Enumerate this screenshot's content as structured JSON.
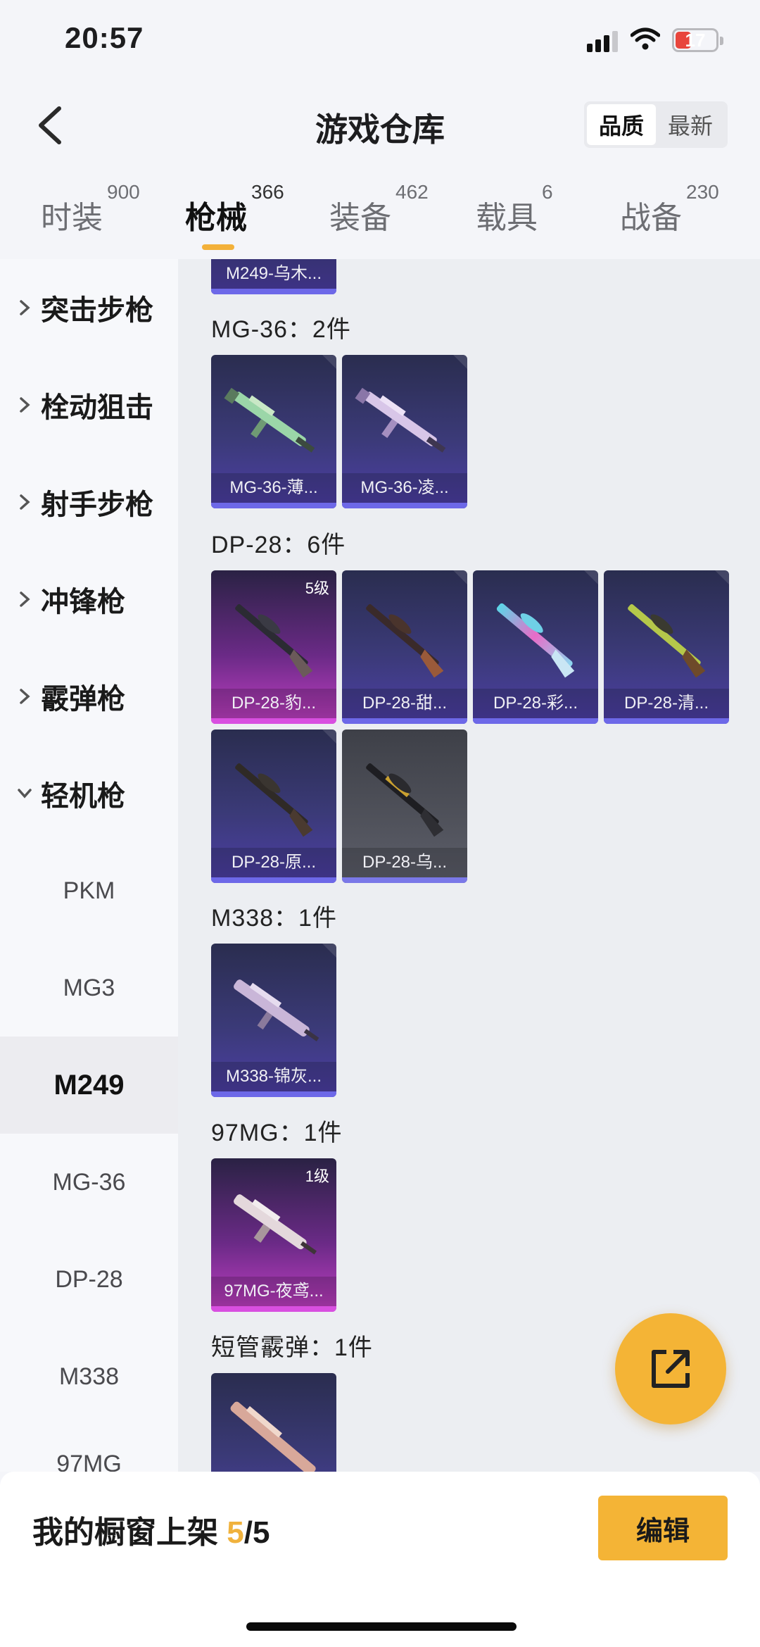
{
  "status_bar": {
    "time": "20:57",
    "battery": "17"
  },
  "header": {
    "title": "游戏仓库",
    "sort_options": [
      "品质",
      "最新"
    ]
  },
  "tabs": [
    {
      "label": "时装",
      "count": "900"
    },
    {
      "label": "枪械",
      "count": "366"
    },
    {
      "label": "装备",
      "count": "462"
    },
    {
      "label": "载具",
      "count": "6"
    },
    {
      "label": "战备",
      "count": "230"
    }
  ],
  "sidebar": {
    "categories": [
      "突击步枪",
      "栓动狙击",
      "射手步枪",
      "冲锋枪",
      "霰弹枪",
      "轻机枪"
    ],
    "subitems": [
      "PKM",
      "MG3",
      "M249",
      "MG-36",
      "DP-28",
      "M338",
      "97MG"
    ]
  },
  "content": {
    "top_partial_label": "M249-乌木...",
    "groups": [
      {
        "title": "MG-36：2件",
        "items": [
          {
            "label": "MG-36-薄...",
            "level": ""
          },
          {
            "label": "MG-36-凌...",
            "level": ""
          }
        ]
      },
      {
        "title": "DP-28：6件",
        "items": [
          {
            "label": "DP-28-豹...",
            "level": "5级"
          },
          {
            "label": "DP-28-甜...",
            "level": ""
          },
          {
            "label": "DP-28-彩...",
            "level": ""
          },
          {
            "label": "DP-28-清...",
            "level": ""
          },
          {
            "label": "DP-28-原...",
            "level": ""
          },
          {
            "label": "DP-28-乌...",
            "level": ""
          }
        ]
      },
      {
        "title": "M338：1件",
        "items": [
          {
            "label": "M338-锦灰...",
            "level": ""
          }
        ]
      },
      {
        "title": "97MG：1件",
        "items": [
          {
            "label": "97MG-夜鸢...",
            "level": "1级"
          }
        ]
      },
      {
        "title": "短管霰弹：1件",
        "items": []
      }
    ]
  },
  "bottom": {
    "showcase_label": "我的橱窗上架",
    "showcase_current": "5",
    "showcase_total": "/5",
    "edit_label": "编辑"
  },
  "colors": {
    "accent": "#f4b436",
    "card_purple": "#4d3fa6",
    "card_pink": "#c23fc4"
  },
  "icons": [
    "back-icon",
    "chevron-right-icon",
    "chevron-down-icon",
    "share-icon",
    "signal-icon",
    "wifi-icon",
    "battery-icon"
  ]
}
